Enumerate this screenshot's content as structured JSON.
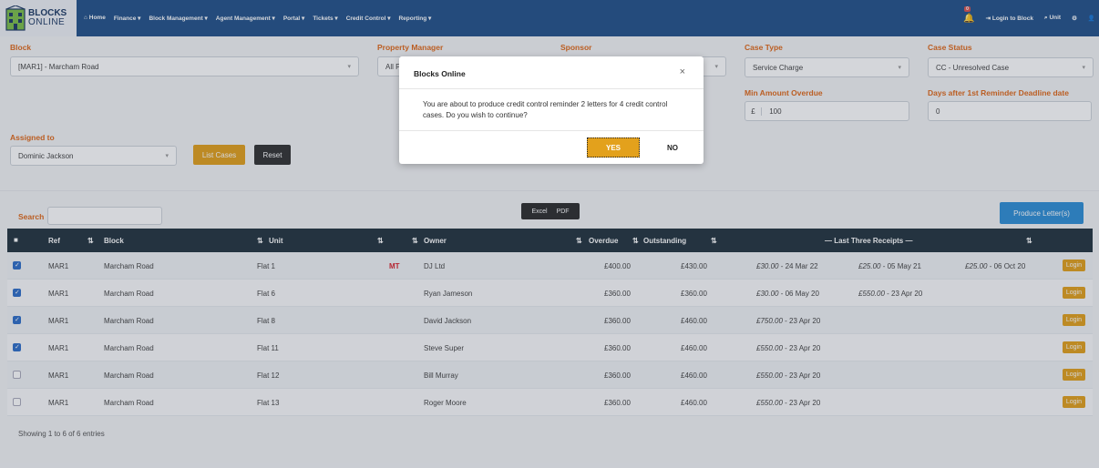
{
  "nav": {
    "logo_line1": "BLOCKS",
    "logo_line2": "ONLINE",
    "links": [
      "Home",
      "Finance",
      "Block Management",
      "Agent Management",
      "Portal",
      "Tickets",
      "Credit Control",
      "Reporting"
    ],
    "notifications": "0",
    "login_to_block": "Login to Block",
    "unit": "Unit"
  },
  "filters": {
    "block_label": "Block",
    "block_value": "[MAR1] - Marcham Road",
    "pm_label": "Property Manager",
    "pm_value": "All P",
    "sponsor_label": "Sponsor",
    "case_type_label": "Case Type",
    "case_type_value": "Service Charge",
    "case_status_label": "Case Status",
    "case_status_value": "CC - Unresolved Case",
    "min_amount_label": "Min Amount Overdue",
    "currency": "£",
    "min_amount_value": "100",
    "days_label": "Days after 1st Reminder Deadline date",
    "days_value": "0",
    "assigned_label": "Assigned to",
    "assigned_value": "Dominic Jackson",
    "list_cases": "List Cases",
    "reset": "Reset"
  },
  "toolbar": {
    "search_label": "Search",
    "search_value": "",
    "excel": "Excel",
    "pdf": "PDF",
    "produce": "Produce Letter(s)"
  },
  "table": {
    "headers": {
      "ref": "Ref",
      "block": "Block",
      "unit": "Unit",
      "owner": "Owner",
      "overdue": "Overdue",
      "outstanding": "Outstanding",
      "receipts": "— Last Three Receipts —"
    },
    "rows": [
      {
        "checked": true,
        "ref": "MAR1",
        "block": "Marcham Road",
        "unit": "Flat 1",
        "flag": "MT",
        "owner": "DJ Ltd",
        "overdue": "£400.00",
        "outstanding": "£430.00",
        "r1a": "£30.00",
        "r1b": " - 24 Mar 22",
        "r2a": "£25.00",
        "r2b": " - 05 May 21",
        "r3a": "£25.00",
        "r3b": " - 06 Oct 20",
        "login": "Login"
      },
      {
        "checked": true,
        "ref": "MAR1",
        "block": "Marcham Road",
        "unit": "Flat 6",
        "flag": "",
        "owner": "Ryan Jameson",
        "overdue": "£360.00",
        "outstanding": "£360.00",
        "r1a": "£30.00",
        "r1b": " - 06 May 20",
        "r2a": "£550.00",
        "r2b": " - 23 Apr 20",
        "r3a": "",
        "r3b": "",
        "login": "Login"
      },
      {
        "checked": true,
        "ref": "MAR1",
        "block": "Marcham Road",
        "unit": "Flat 8",
        "flag": "",
        "owner": "David Jackson",
        "overdue": "£360.00",
        "outstanding": "£460.00",
        "r1a": "£750.00",
        "r1b": " - 23 Apr 20",
        "r2a": "",
        "r2b": "",
        "r3a": "",
        "r3b": "",
        "login": "Login"
      },
      {
        "checked": true,
        "ref": "MAR1",
        "block": "Marcham Road",
        "unit": "Flat 11",
        "flag": "",
        "owner": "Steve Super",
        "overdue": "£360.00",
        "outstanding": "£460.00",
        "r1a": "£550.00",
        "r1b": " - 23 Apr 20",
        "r2a": "",
        "r2b": "",
        "r3a": "",
        "r3b": "",
        "login": "Login"
      },
      {
        "checked": false,
        "ref": "MAR1",
        "block": "Marcham Road",
        "unit": "Flat 12",
        "flag": "",
        "owner": "Bill Murray",
        "overdue": "£360.00",
        "outstanding": "£460.00",
        "r1a": "£550.00",
        "r1b": " - 23 Apr 20",
        "r2a": "",
        "r2b": "",
        "r3a": "",
        "r3b": "",
        "login": "Login"
      },
      {
        "checked": false,
        "ref": "MAR1",
        "block": "Marcham Road",
        "unit": "Flat 13",
        "flag": "",
        "owner": "Roger Moore",
        "overdue": "£360.00",
        "outstanding": "£460.00",
        "r1a": "£550.00",
        "r1b": " - 23 Apr 20",
        "r2a": "",
        "r2b": "",
        "r3a": "",
        "r3b": "",
        "login": "Login"
      }
    ],
    "footer": "Showing 1 to 6 of 6 entries"
  },
  "modal": {
    "title": "Blocks Online",
    "close": "×",
    "message": "You are about to produce credit control reminder 2 letters for 4 credit control cases. Do you wish to continue?",
    "yes": "YES",
    "no": "NO"
  },
  "colors": {
    "navbar": "#23528a",
    "accent_orange": "#e06a1b",
    "button_gold": "#e3a11c",
    "button_blue": "#2f8fd6",
    "table_header": "#24343f",
    "mt_flag": "#d9232d"
  }
}
